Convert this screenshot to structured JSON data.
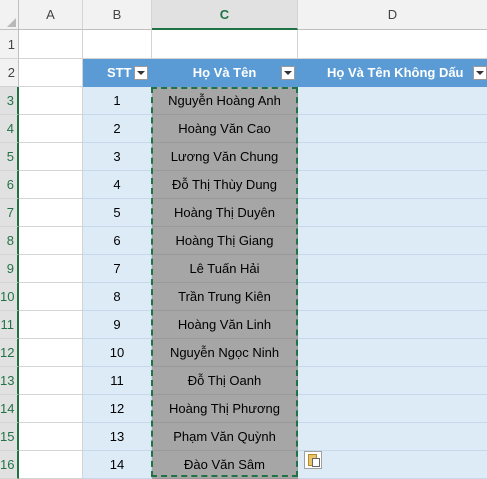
{
  "columns": [
    "A",
    "B",
    "C",
    "D"
  ],
  "rows": [
    "1",
    "2",
    "3",
    "4",
    "5",
    "6",
    "7",
    "8",
    "9",
    "10",
    "11",
    "12",
    "13",
    "14",
    "15",
    "16"
  ],
  "headers": {
    "stt": "STT",
    "ho_va_ten": "Họ Và Tên",
    "khong_dau": "Họ Và Tên Không Dấu"
  },
  "records": [
    {
      "stt": "1",
      "name": "Nguyễn Hoàng Anh"
    },
    {
      "stt": "2",
      "name": "Hoàng Văn Cao"
    },
    {
      "stt": "3",
      "name": "Lương Văn Chung"
    },
    {
      "stt": "4",
      "name": "Đỗ Thị Thùy Dung"
    },
    {
      "stt": "5",
      "name": "Hoàng Thị Duyên"
    },
    {
      "stt": "6",
      "name": "Hoàng Thị Giang"
    },
    {
      "stt": "7",
      "name": "Lê Tuấn Hải"
    },
    {
      "stt": "8",
      "name": "Trần Trung Kiên"
    },
    {
      "stt": "9",
      "name": "Hoàng Văn Linh"
    },
    {
      "stt": "10",
      "name": "Nguyễn Ngọc Ninh"
    },
    {
      "stt": "11",
      "name": "Đỗ Thị Oanh"
    },
    {
      "stt": "12",
      "name": "Hoàng Thị Phương"
    },
    {
      "stt": "13",
      "name": "Phạm Văn Quỳnh"
    },
    {
      "stt": "14",
      "name": "Đào Văn Sâm"
    }
  ],
  "colors": {
    "header_fill": "#5b9bd5",
    "band_fill": "#ddebf7",
    "selection_fill": "#a6a6a6",
    "accent": "#217346"
  },
  "icons": {
    "paste_options": "paste-options-icon",
    "filter": "filter-dropdown-icon"
  }
}
